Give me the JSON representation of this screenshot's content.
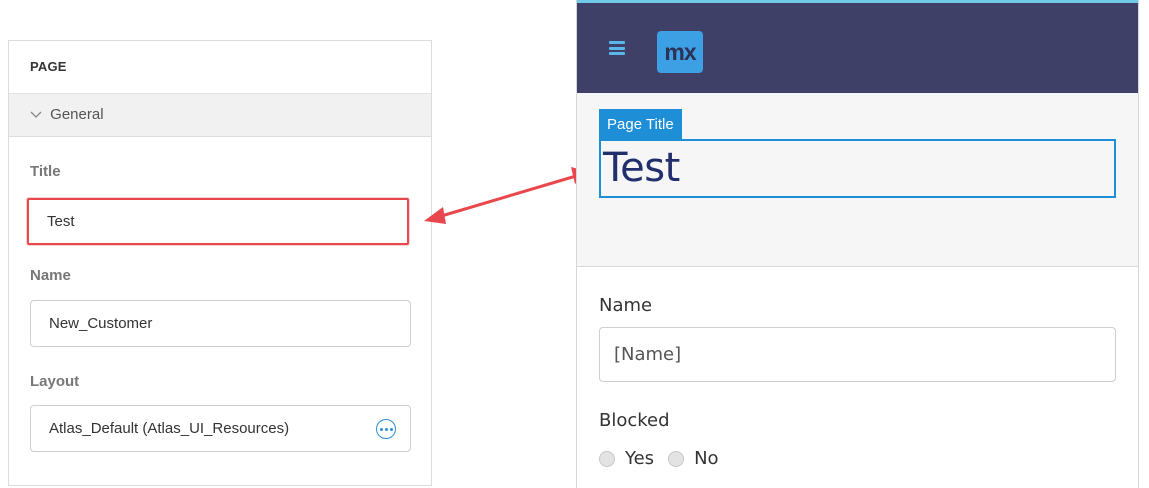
{
  "props": {
    "header": "PAGE",
    "section": "General",
    "title_label": "Title",
    "title_value": "Test",
    "name_label": "Name",
    "name_value": "New_Customer",
    "layout_label": "Layout",
    "layout_value": "Atlas_Default (Atlas_UI_Resources)"
  },
  "preview": {
    "logo": "mx",
    "page_title_tag": "Page Title",
    "page_title_value": "Test",
    "name_label": "Name",
    "name_placeholder": "[Name]",
    "blocked_label": "Blocked",
    "radio_yes": "Yes",
    "radio_no": "No"
  },
  "colors": {
    "highlight": "#e8484d",
    "topbar": "#3e4067",
    "accent": "#1e8fd6",
    "arrow": "#e8484d"
  }
}
